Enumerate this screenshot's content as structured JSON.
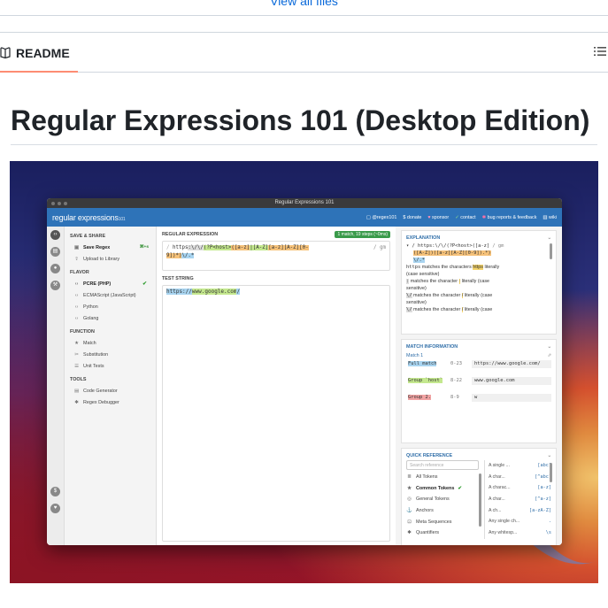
{
  "top": {
    "more_link": "View all files"
  },
  "readme": {
    "tab_label": "README"
  },
  "page": {
    "title": "Regular Expressions 101 (Desktop Edition)"
  },
  "app": {
    "window_title": "Regular Expressions 101",
    "logo_main": "regular expressions",
    "logo_sub": "101",
    "nav": {
      "user": "@regex101",
      "donate": "donate",
      "sponsor": "sponsor",
      "contact": "contact",
      "bugs": "bug reports & feedback",
      "wiki": "wiki"
    },
    "sidebar": {
      "save_share_header": "SAVE & SHARE",
      "save_regex": "Save Regex",
      "save_shortcut": "⌘+s",
      "upload": "Upload to Library",
      "flavor_header": "FLAVOR",
      "flavors": [
        "PCRE (PHP)",
        "ECMAScript (JavaScript)",
        "Python",
        "Golang"
      ],
      "function_header": "FUNCTION",
      "functions": [
        "Match",
        "Substitution",
        "Unit Tests"
      ],
      "tools_header": "TOOLS",
      "tools": [
        "Code Generator",
        "Regex Debugger"
      ]
    },
    "regex": {
      "header": "REGULAR EXPRESSION",
      "badge": "1 match, 19 steps (~0ms)",
      "delim": "/",
      "p1": "https",
      "p2": ":\\/\\/",
      "p3": "(?P<host>",
      "p4": "([a-z]",
      "p5": "|[A-Z]",
      "p6": "[a-z]",
      "p7": "[A-Z]",
      "p8": "[0-",
      "p9": "9])*)",
      "p10": "\\/.*",
      "flags": "/ gm"
    },
    "test": {
      "header": "TEST STRING",
      "p1": "https://",
      "p2": "www.google.com",
      "p3": "/"
    },
    "explanation": {
      "header": "EXPLANATION",
      "regex_line1": "/ https:\\/\\/(?P<host>([a-z]",
      "regex_flags": "/ gm",
      "regex_line2": "([A-Z])([a-z][A-Z][0-9]).*)",
      "regex_line3": "\\/.*",
      "line_https_code": "https",
      "line_https_text": " matches the characters ",
      "line_https_hl": "https",
      "line_https_end": " literally",
      "case": "(case sensitive)",
      "line_colon_code": ":",
      "line_colon_text": " matches the character ",
      "line_colon_hl": ":",
      "line_colon_end": " literally (case",
      "sensitive": "sensitive)",
      "line_slash_code": "\\/",
      "line_slash_text": " matches the character ",
      "line_slash_hl": "/",
      "line_slash_end": " literally (case",
      "sensitive2": "sensitive)",
      "line_slash2_code": "\\/",
      "line_slash2_text": " matches the character ",
      "line_slash2_hl": "/",
      "line_slash2_end": " literally (case"
    },
    "match": {
      "header": "MATCH INFORMATION",
      "match_label": "Match 1",
      "rows": [
        {
          "k": "Full match",
          "r": "0-23",
          "v": "https://www.google.com/"
        },
        {
          "k": "Group `host`",
          "r": "8-22",
          "v": "www.google.com"
        },
        {
          "k": "Group 2.",
          "r": "8-9",
          "v": "w"
        }
      ]
    },
    "quickref": {
      "header": "QUICK REFERENCE",
      "placeholder": "Search reference",
      "items": [
        "All Tokens",
        "Common Tokens",
        "General Tokens",
        "Anchors",
        "Meta Sequences",
        "Quantifiers"
      ],
      "right": [
        {
          "t": "A single ...",
          "c": "[abc]"
        },
        {
          "t": "A char...",
          "c": "[^abc]"
        },
        {
          "t": "A charac...",
          "c": "[a-z]"
        },
        {
          "t": "A char...",
          "c": "[^a-z]"
        },
        {
          "t": "A ch...",
          "c": "[a-zA-Z]"
        },
        {
          "t": "Any single ch...",
          "c": "."
        },
        {
          "t": "Any whitesp...",
          "c": "\\s"
        }
      ]
    }
  }
}
